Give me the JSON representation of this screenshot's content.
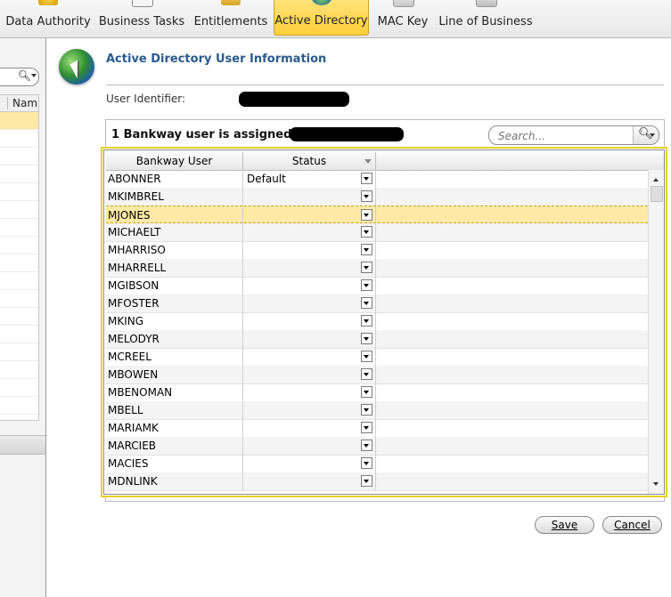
{
  "ribbon": {
    "tabs": [
      {
        "label": "Data Authority",
        "icon": "data-authority-icon"
      },
      {
        "label": "Business Tasks",
        "icon": "business-tasks-icon"
      },
      {
        "label": "Entitlements",
        "icon": "entitlements-icon"
      },
      {
        "label": "Active Directory",
        "icon": "active-directory-icon",
        "active": true
      },
      {
        "label": "MAC Key",
        "icon": "mac-key-icon"
      },
      {
        "label": "Line of Business",
        "icon": "line-of-business-icon"
      }
    ]
  },
  "left_pane": {
    "column_header": "Nam"
  },
  "main": {
    "title": "Active Directory User Information",
    "user_identifier_label": "User Identifier:",
    "group_caption": "1 Bankway user is assigned to",
    "search": {
      "placeholder": "Search..."
    },
    "grid": {
      "columns": [
        "Bankway User",
        "Status"
      ],
      "rows": [
        {
          "user": "ABONNER",
          "status": "Default"
        },
        {
          "user": "MKIMBREL",
          "status": ""
        },
        {
          "user": "MJONES",
          "status": "",
          "selected": true
        },
        {
          "user": "MICHAELT",
          "status": ""
        },
        {
          "user": "MHARRISO",
          "status": ""
        },
        {
          "user": "MHARRELL",
          "status": ""
        },
        {
          "user": "MGIBSON",
          "status": ""
        },
        {
          "user": "MFOSTER",
          "status": ""
        },
        {
          "user": "MKING",
          "status": ""
        },
        {
          "user": "MELODYR",
          "status": ""
        },
        {
          "user": "MCREEL",
          "status": ""
        },
        {
          "user": "MBOWEN",
          "status": ""
        },
        {
          "user": "MBENOMAN",
          "status": ""
        },
        {
          "user": "MBELL",
          "status": ""
        },
        {
          "user": "MARIAMK",
          "status": ""
        },
        {
          "user": "MARCIEB",
          "status": ""
        },
        {
          "user": "MACIES",
          "status": ""
        },
        {
          "user": "MDNLINK",
          "status": ""
        }
      ]
    },
    "buttons": {
      "save": "Save",
      "cancel": "Cancel"
    }
  },
  "colors": {
    "accent_title": "#2a5a8f",
    "selection": "#ffe9a6",
    "active_tab": "#ffd54a",
    "grid_highlight_border": "#e6cf22"
  }
}
